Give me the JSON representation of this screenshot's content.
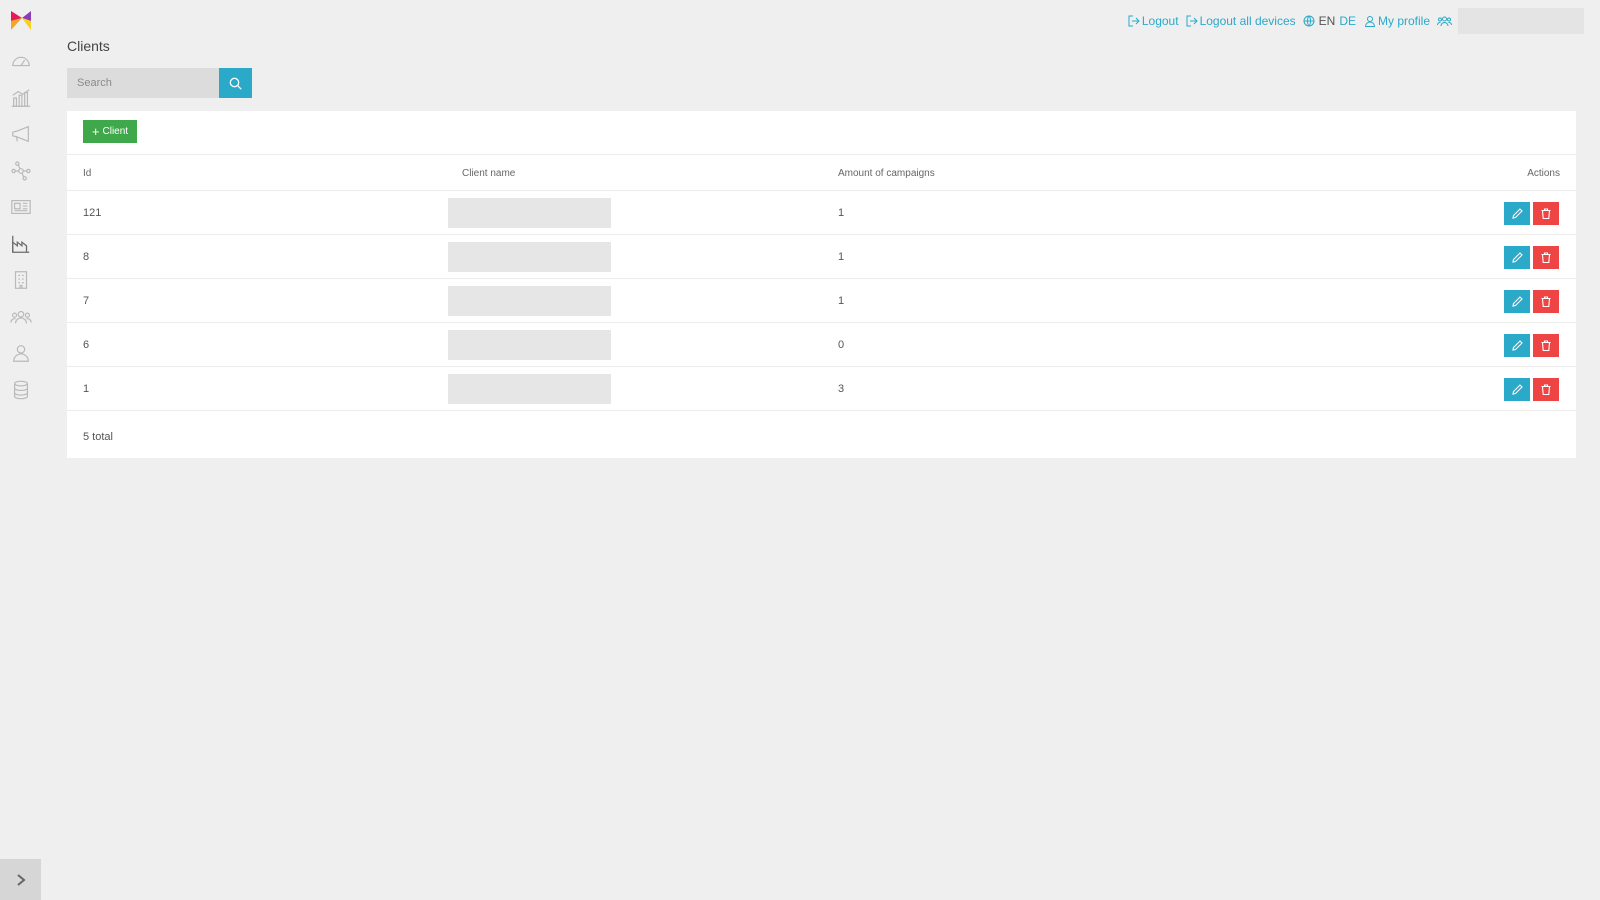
{
  "sidebar": {
    "items": [
      {
        "icon": "speedometer-icon"
      },
      {
        "icon": "bar-chart-icon"
      },
      {
        "icon": "megaphone-icon"
      },
      {
        "icon": "network-icon"
      },
      {
        "icon": "newspaper-icon"
      },
      {
        "icon": "factory-icon"
      },
      {
        "icon": "building-icon"
      },
      {
        "icon": "group-icon"
      },
      {
        "icon": "user-icon"
      },
      {
        "icon": "database-icon"
      }
    ]
  },
  "topbar": {
    "logout_label": "Logout",
    "logout_all_label": "Logout all devices",
    "lang_en": "EN",
    "lang_de": "DE",
    "profile_label": "My profile"
  },
  "page": {
    "title": "Clients"
  },
  "search": {
    "placeholder": "Search",
    "value": ""
  },
  "actions": {
    "add_label": "Client"
  },
  "table": {
    "columns": [
      "Id",
      "Client name",
      "Amount of campaigns",
      "Actions"
    ],
    "rows": [
      {
        "id": "121",
        "amount": "1"
      },
      {
        "id": "8",
        "amount": "1"
      },
      {
        "id": "7",
        "amount": "1"
      },
      {
        "id": "6",
        "amount": "0"
      },
      {
        "id": "1",
        "amount": "3"
      }
    ],
    "total": "5 total"
  },
  "colors": {
    "accent": "#2aa9c9",
    "add": "#3fa84a",
    "delete": "#ee4444",
    "background": "#efefef"
  }
}
